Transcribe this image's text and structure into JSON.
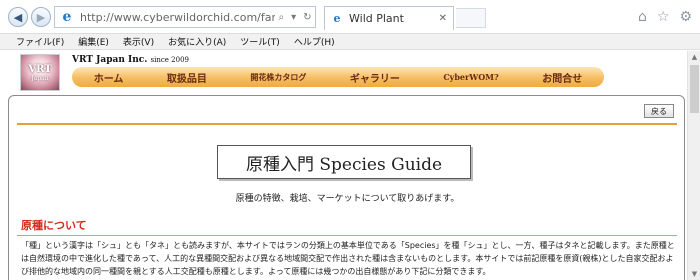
{
  "browser": {
    "address_url": "http://www.cyberwildorchid.com/family/wildplant.html",
    "tab_title": "Wild Plant",
    "back_icon": "back-arrow-icon",
    "forward_icon": "forward-arrow-icon"
  },
  "menubar": {
    "items": [
      "ファイル(F)",
      "編集(E)",
      "表示(V)",
      "お気に入り(A)",
      "ツール(T)",
      "ヘルプ(H)"
    ]
  },
  "site": {
    "logo_line1": "VRT",
    "logo_line2": "Japan",
    "company": "VRT Japan Inc.",
    "since": "since 2009",
    "nav": [
      "ホーム",
      "取扱品目",
      "開花株カタログ",
      "ギャラリー",
      "CyberWOM?",
      "お問合せ"
    ]
  },
  "content": {
    "back_button": "戻る",
    "title": "原種入門 Species Guide",
    "lead": "原種の特徴、栽培、マーケットについて取りあげます。",
    "section_heading": "原種について",
    "paragraph": "「種」という漢字は「シュ」とも「タネ」とも読みますが、本サイトではランの分類上の基本単位である「Species」を種「シュ」とし、一方、種子はタネと記載します。また原種とは自然環境の中で進化した種であって、人工的な異種間交配および異なる地域間交配で作出された種は含まないものとします。本サイトでは前記原種を原資(親株)とした自家交配および排他的な地域内の同一種間を親とする人工交配種も原種とします。よって原種には幾つかの出自様態があり下記に分類できます。"
  },
  "colors": {
    "accent_orange": "#f1aa3f",
    "section_red": "#d12b1b",
    "nav_text": "#6a2a12"
  }
}
